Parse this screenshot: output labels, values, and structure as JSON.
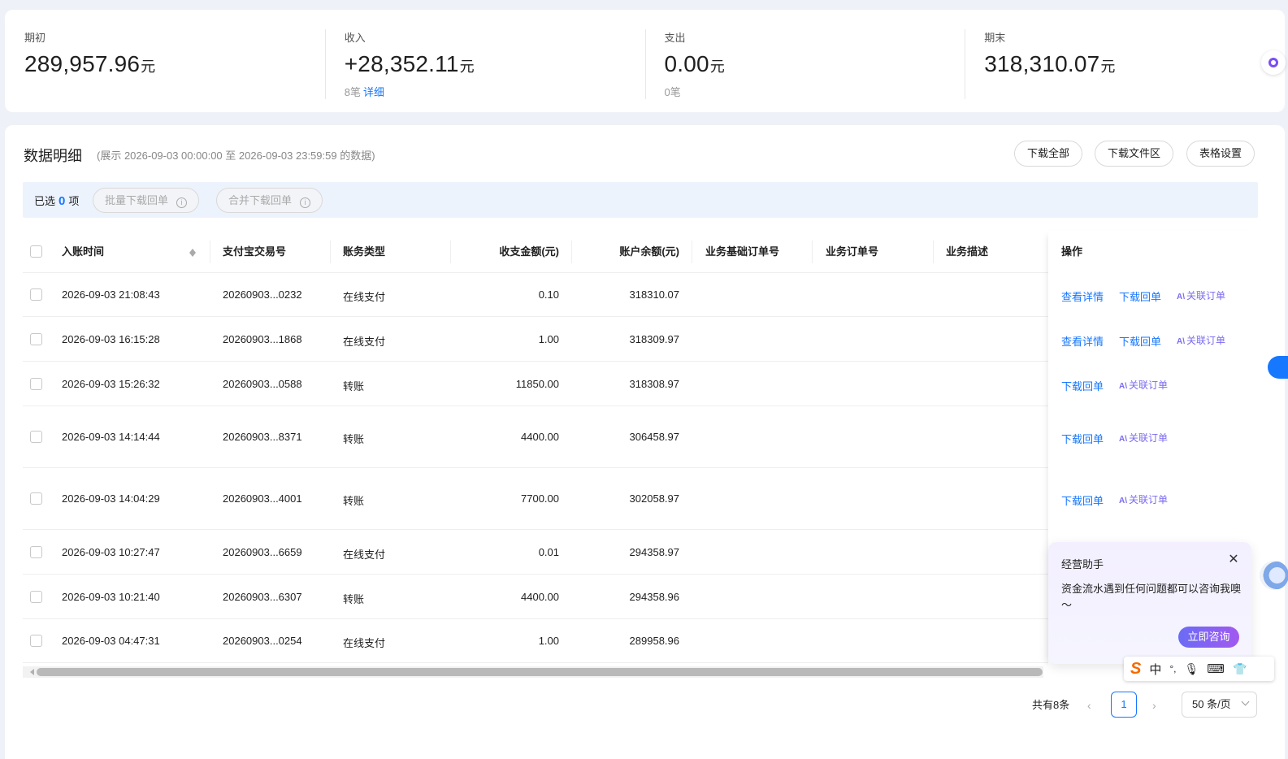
{
  "summary": [
    {
      "label": "期初",
      "value": "289,957.96",
      "unit": "元",
      "count": "",
      "link": ""
    },
    {
      "label": "收入",
      "value": "+28,352.11",
      "unit": "元",
      "count": "8笔",
      "link": "详细"
    },
    {
      "label": "支出",
      "value": "0.00",
      "unit": "元",
      "count": "0笔",
      "link": ""
    },
    {
      "label": "期末",
      "value": "318,310.07",
      "unit": "元",
      "count": "",
      "link": ""
    }
  ],
  "detail": {
    "title": "数据明细",
    "range": "(展示 2026-09-03 00:00:00 至 2026-09-03 23:59:59 的数据)",
    "buttons": {
      "download_all": "下载全部",
      "download_folder": "下载文件区",
      "table_settings": "表格设置"
    }
  },
  "selection": {
    "prefix": "已选",
    "count": "0",
    "suffix": "项",
    "batch": "批量下载回单",
    "merge": "合并下载回单"
  },
  "table": {
    "headers": [
      "入账时间",
      "支付宝交易号",
      "账务类型",
      "收支金额(元)",
      "账户余额(元)",
      "业务基础订单号",
      "业务订单号",
      "业务描述",
      "操作"
    ],
    "rows": [
      {
        "time": "2026-09-03 21:08:43",
        "trade_no": "20260903...0232",
        "type": "在线支付",
        "amount": "0.10",
        "balance": "318310.07",
        "ops": [
          "查看详情",
          "下载回单",
          "关联订单"
        ]
      },
      {
        "time": "2026-09-03 16:15:28",
        "trade_no": "20260903...1868",
        "type": "在线支付",
        "amount": "1.00",
        "balance": "318309.97",
        "ops": [
          "查看详情",
          "下载回单",
          "关联订单"
        ]
      },
      {
        "time": "2026-09-03 15:26:32",
        "trade_no": "20260903...0588",
        "type": "转账",
        "amount": "11850.00",
        "balance": "318308.97",
        "ops": [
          "下载回单",
          "关联订单"
        ]
      },
      {
        "time": "2026-09-03 14:14:44",
        "trade_no": "20260903...8371",
        "type": "转账",
        "amount": "4400.00",
        "balance": "306458.97",
        "ops": [
          "下载回单",
          "关联订单"
        ]
      },
      {
        "time": "2026-09-03 14:04:29",
        "trade_no": "20260903...4001",
        "type": "转账",
        "amount": "7700.00",
        "balance": "302058.97",
        "ops": [
          "下载回单",
          "关联订单"
        ]
      },
      {
        "time": "2026-09-03 10:27:47",
        "trade_no": "20260903...6659",
        "type": "在线支付",
        "amount": "0.01",
        "balance": "294358.97",
        "ops": []
      },
      {
        "time": "2026-09-03 10:21:40",
        "trade_no": "20260903...6307",
        "type": "转账",
        "amount": "4400.00",
        "balance": "294358.96",
        "ops": []
      },
      {
        "time": "2026-09-03 04:47:31",
        "trade_no": "20260903...0254",
        "type": "在线支付",
        "amount": "1.00",
        "balance": "289958.96",
        "ops": []
      }
    ]
  },
  "pagination": {
    "total": "共有8条",
    "current": "1",
    "page_size": "50 条/页"
  },
  "assistant": {
    "title": "经营助手",
    "message": "资金流水遇到任何问题都可以咨询我噢～",
    "button": "立即咨询"
  },
  "ime": {
    "logo": "S",
    "mode": "中",
    "punct": "°,",
    "voice": "🎙",
    "keyboard": "⌨",
    "skin": "👕"
  },
  "colors": {
    "accent": "#1677ff",
    "ai": "#7a6bf0",
    "background": "#eef2f8"
  }
}
